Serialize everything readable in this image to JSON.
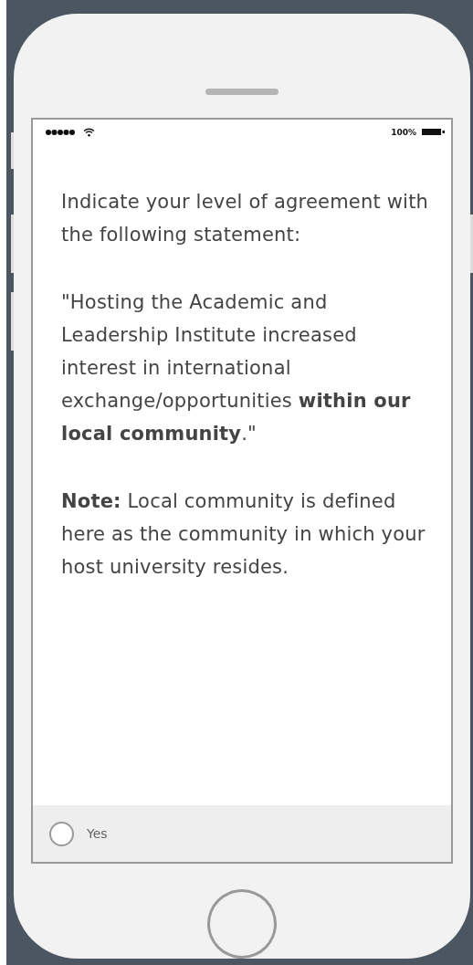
{
  "status_bar": {
    "battery_text": "100%"
  },
  "question": {
    "paragraphs": [
      "Indicate your level of agreement with the following statement:",
      "\"Hosting the Academic and Leadership Institute increased interest in international exchange/opportunities **within our local community**.\"",
      "**Note:** Local community is defined here as the community in which your host university resides."
    ]
  },
  "options": [
    {
      "label": "Yes",
      "selected": false
    }
  ]
}
